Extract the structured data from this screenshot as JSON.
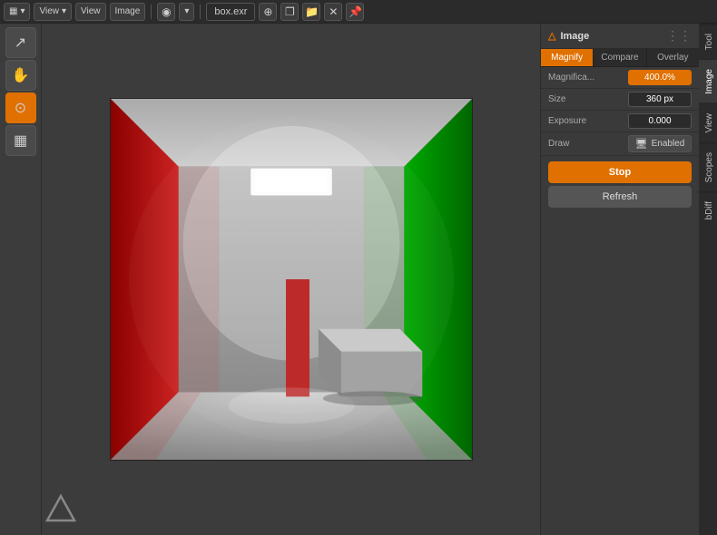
{
  "topbar": {
    "editor_icon": "▦",
    "view_label": "View",
    "view_dropdown": "View",
    "image_label": "Image",
    "render_icon": "◉",
    "filename": "box.exr",
    "shield_icon": "⊕",
    "copy_icon": "❐",
    "folder_icon": "📁",
    "close_icon": "✕",
    "pin_icon": "📌"
  },
  "toolbar": {
    "tools": [
      {
        "name": "cursor",
        "icon": "↗",
        "active": false
      },
      {
        "name": "hand",
        "icon": "✋",
        "active": false
      },
      {
        "name": "zoom",
        "icon": "⊙",
        "active": true
      },
      {
        "name": "checker",
        "icon": "▦",
        "active": false
      }
    ]
  },
  "panel": {
    "title": "Image",
    "title_icon": "△",
    "dots": "⋮⋮",
    "tabs": [
      {
        "label": "Magnify",
        "active": true
      },
      {
        "label": "Compare",
        "active": false
      },
      {
        "label": "Overlay",
        "active": false
      }
    ],
    "properties": [
      {
        "label": "Magnifica...",
        "value": "400.0%",
        "type": "orange"
      },
      {
        "label": "Size",
        "value": "360 px",
        "type": "normal"
      },
      {
        "label": "Exposure",
        "value": "0.000",
        "type": "normal"
      }
    ],
    "draw_label": "Draw",
    "draw_icon": "🖥",
    "draw_value": "Enabled",
    "stop_label": "Stop",
    "refresh_label": "Refresh"
  },
  "side_tabs": [
    {
      "label": "Tool",
      "active": false
    },
    {
      "label": "Image",
      "active": false
    },
    {
      "label": "View",
      "active": false
    },
    {
      "label": "Scopes",
      "active": false
    },
    {
      "label": "bDiff",
      "active": false
    }
  ],
  "logo": "△"
}
